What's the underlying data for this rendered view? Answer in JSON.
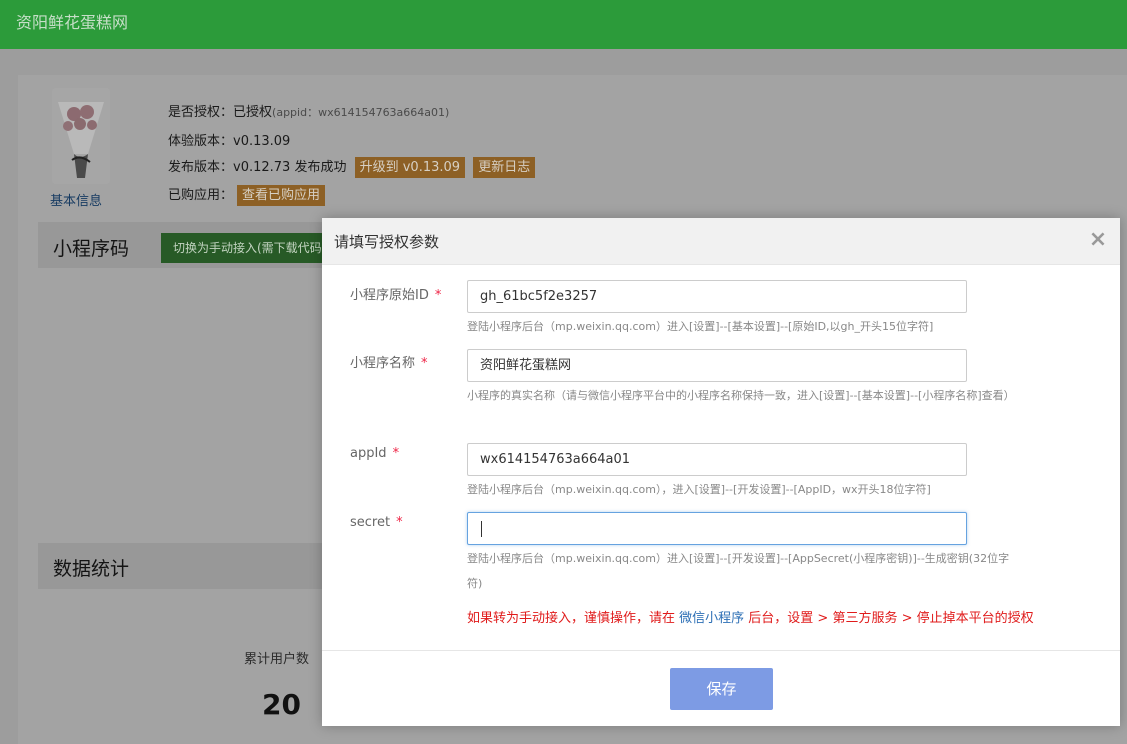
{
  "header": {
    "site_name": "资阳鲜花蛋糕网"
  },
  "sidebar_link": {
    "basic_info": "基本信息"
  },
  "info": {
    "authorized_label": "是否授权：",
    "authorized_value": "已授权",
    "authorized_appid": "(appid：wx614154763a664a01)",
    "trial_label": "体验版本：",
    "trial_value": "v0.13.09",
    "release_label": "发布版本：",
    "release_value": "v0.12.73 发布成功",
    "upgrade_tag": "升级到 v0.13.09",
    "changelog_tag": "更新日志",
    "purchased_label": "已购应用：",
    "purchased_tag": "查看已购应用"
  },
  "miniprogram_code": {
    "title": "小程序码",
    "switch_button": "切换为手动接入(需下载代码"
  },
  "stats": {
    "title": "数据统计",
    "total_users_label": "累计用户数",
    "total_users_value": "20"
  },
  "modal": {
    "title": "请填写授权参数",
    "close": "×",
    "fields": [
      {
        "label": "小程序原始ID",
        "required": "*",
        "value": "gh_61bc5f2e3257",
        "help": "登陆小程序后台（mp.weixin.qq.com）进入[设置]--[基本设置]--[原始ID,以gh_开头15位字符]"
      },
      {
        "label": "小程序名称",
        "required": "*",
        "value": "资阳鲜花蛋糕网",
        "help": "小程序的真实名称（请与微信小程序平台中的小程序名称保持一致，进入[设置]--[基本设置]--[小程序名称]查看）"
      },
      {
        "label": "appId",
        "required": "*",
        "value": "wx614154763a664a01",
        "help": "登陆小程序后台（mp.weixin.qq.com），进入[设置]--[开发设置]--[AppID，wx开头18位字符]"
      },
      {
        "label": "secret",
        "required": "*",
        "value": "",
        "help": "登陆小程序后台（mp.weixin.qq.com）进入[设置]--[开发设置]--[AppSecret(小程序密钥)]--生成密钥(32位字符)"
      }
    ],
    "warning_pre": "如果转为手动接入，谨慎操作，请在 ",
    "warning_link": "微信小程序",
    "warning_post": " 后台，设置 > 第三方服务 > 停止掉本平台的授权",
    "save_button": "保存"
  },
  "colors": {
    "topbar": "#2c9b3a",
    "tag": "#8d6025",
    "save_button": "#7d9be4",
    "warning": "#e01b1b",
    "required_mark": "#ee2244"
  },
  "icons": {
    "close": "close-icon",
    "product_thumbnail": "bouquet-image"
  }
}
